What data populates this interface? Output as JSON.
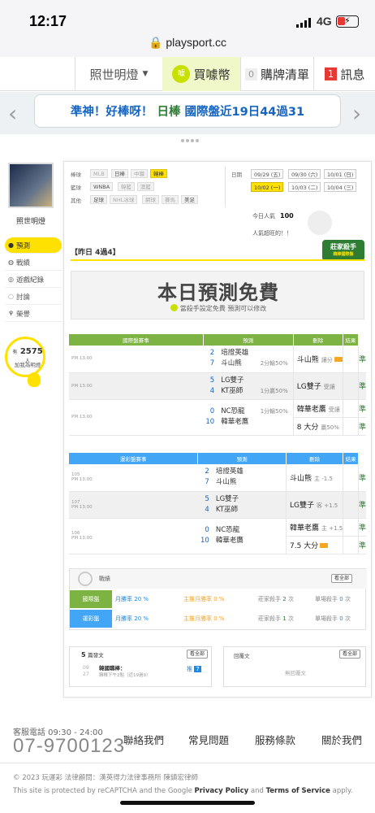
{
  "status_bar": {
    "time": "12:17",
    "network": "4G",
    "url": "playsport.cc"
  },
  "nav": {
    "user": "照世明燈",
    "coin": "買噱幣",
    "cart_count": "0",
    "cart": "購牌清單",
    "msg_count": "1",
    "msg": "訊息"
  },
  "banner": {
    "text_a": "準神！好棒呀！",
    "text_b": "日棒",
    "text_c": "國際盤近19日44過31"
  },
  "sidebar": {
    "username": "照世明燈",
    "items": [
      {
        "label": "預測",
        "icon": "user-icon"
      },
      {
        "label": "戰績",
        "icon": "chat-icon"
      },
      {
        "label": "遊戲紀錄",
        "icon": "settings-icon"
      },
      {
        "label": "討論",
        "icon": "comment-icon"
      },
      {
        "label": "榮譽",
        "icon": "trophy-icon"
      }
    ],
    "fans_prefix": "有",
    "fans_count": "2575",
    "fans_suffix": "人",
    "fans_label": "加我為明燈"
  },
  "filters": {
    "baseball_label": "棒球",
    "basketball_label": "籃球",
    "other_label": "其他",
    "baseball": [
      "MLB",
      "日棒",
      "中職",
      "韓棒"
    ],
    "basketball": [
      "WNBA",
      "韓籃",
      "澳籃"
    ],
    "other": [
      "足球",
      "NHL冰球",
      "網球",
      "賽馬",
      "美足"
    ],
    "date_label": "日期",
    "dates": [
      "09/29 (五)",
      "09/30 (六)",
      "10/01 (日)",
      "10/02 (一)",
      "10/03 (二)",
      "10/04 (三)"
    ],
    "selected_date": "10/02 (一)"
  },
  "stats": {
    "visitors_label": "今日人氣",
    "visitors": "100",
    "popularity_label": "人氣超旺的！！"
  },
  "badge": {
    "title": "莊家殺手",
    "sub": "韓棒國際盤"
  },
  "yesterday": "【昨日 4過4】",
  "promo": {
    "title": "本日預測免費",
    "subtitle": "當殺手設定免費  預測可以修改"
  },
  "table_international": {
    "headers": [
      "國際盤賽事",
      "預測",
      "刪除",
      "結果"
    ],
    "rows": [
      {
        "time": "PM 13:00",
        "home_no": "2",
        "home": "培證英雄",
        "away_no": "7",
        "away": "斗山熊",
        "handicap": "2分輸50%",
        "pred": "斗山熊",
        "pred_note": "讓分",
        "result": "準"
      },
      {
        "time": "PM 13:00",
        "home_no": "5",
        "home": "LG雙子",
        "away_no": "4",
        "away": "KT巫師",
        "handicap": "1分贏50%",
        "pred": "LG雙子",
        "pred_note": "受讓",
        "result": "準"
      },
      {
        "time": "PM 13:00",
        "home_no": "0",
        "home": "NC恐龍",
        "away_no": "10",
        "away": "韓華老鷹",
        "handicap": "1分輸50%",
        "pred": "韓華老鷹",
        "pred_note": "受讓",
        "result": "準",
        "pred2": "8 大分",
        "pred2_note": "贏50%",
        "result2": "準"
      }
    ]
  },
  "table_taiwan": {
    "headers": [
      "運彩盤賽事",
      "預測",
      "刪除",
      "結果"
    ],
    "rows": [
      {
        "id": "105",
        "time": "PM 13:00",
        "home_no": "2",
        "home": "培證英雄",
        "away_no": "7",
        "away": "斗山熊",
        "pred": "斗山熊",
        "pred_note": "主 -1.5",
        "result": "準"
      },
      {
        "id": "107",
        "time": "PM 13:00",
        "home_no": "5",
        "home": "LG雙子",
        "away_no": "4",
        "away": "KT巫師",
        "pred": "LG雙子",
        "pred_note": "客 +1.5",
        "result": "準"
      },
      {
        "id": "106",
        "time": "PM 13:00",
        "home_no": "0",
        "home": "NC恐龍",
        "away_no": "10",
        "away": "韓華老鷹",
        "pred": "韓華老鷹",
        "pred_note": "主 +1.5",
        "result": "準",
        "pred2": "7.5 大分",
        "result2": "準"
      }
    ]
  },
  "record": {
    "title": "戰績",
    "see_all": "看全部",
    "rows": [
      {
        "tag": "國際盤",
        "month": "月勝率",
        "month_val": "20 %",
        "main": "主推月勝率",
        "main_val": "0 %",
        "killer": "莊家殺手",
        "killer_val": "2",
        "killer_unit": "次",
        "single": "單場殺手",
        "single_val": "0",
        "single_unit": "次"
      },
      {
        "tag": "運彩盤",
        "month": "月勝率",
        "month_val": "20 %",
        "main": "主推月勝率",
        "main_val": "0 %",
        "killer": "莊家殺手",
        "killer_val": "1",
        "killer_unit": "次",
        "single": "單場殺手",
        "single_val": "0",
        "single_unit": "次"
      }
    ]
  },
  "posts": {
    "count": "5",
    "title": "篇發文",
    "see_all": "看全部",
    "date_m": "09",
    "date_d": "27",
    "post_title": "韓國職棒：",
    "post_sub": "韓棒下午2點（近19過9）",
    "push_label": "推",
    "push_count": "7"
  },
  "replies": {
    "title": "回覆文",
    "see_all": "看全部",
    "empty": "無回覆文"
  },
  "footer": {
    "tel_label": "客服電話 09:30 - 24:00",
    "tel": "07-9700123",
    "links": [
      "聯絡我們",
      "常見問題",
      "服務條款",
      "關於我們"
    ],
    "copyright": "© 2023 玩運彩 法律顧問：漢英得力法律事務所 陳鎮宏律師",
    "recaptcha_a": "This site is protected by reCAPTCHA and the Google ",
    "privacy": "Privacy Policy",
    "and": " and ",
    "terms": "Terms of Service",
    "apply": " apply."
  },
  "colors": {
    "accent": "#ffe100",
    "green": "#7cb342",
    "blue": "#42a5f5",
    "link": "#1565c0"
  }
}
